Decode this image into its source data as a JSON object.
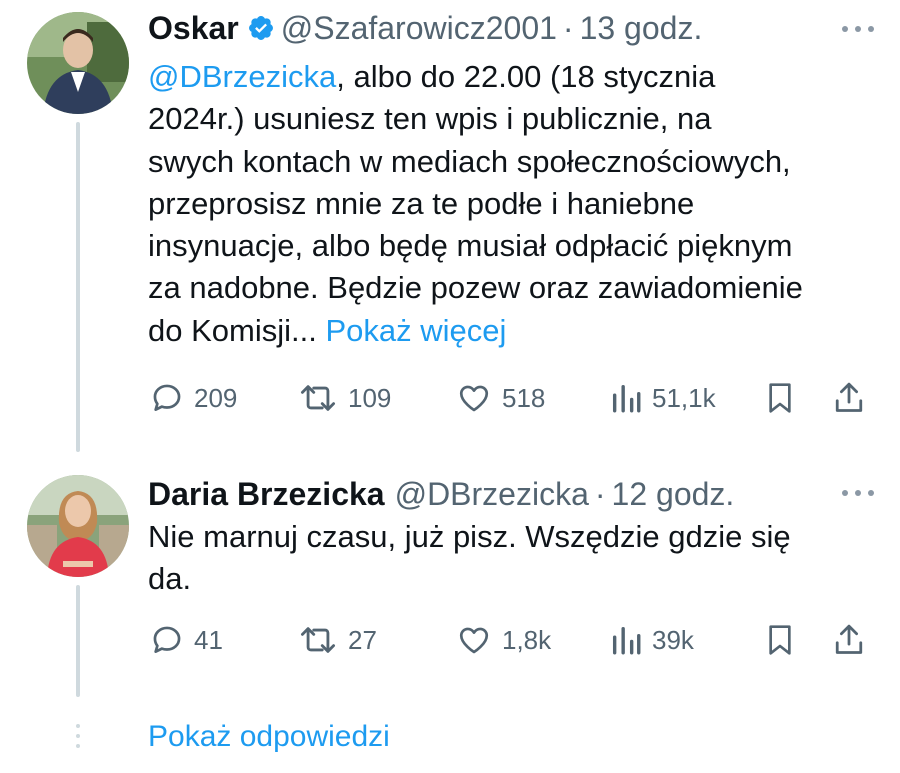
{
  "tweets": [
    {
      "name": "Oskar",
      "verified": true,
      "handle": "@Szafarowicz2001",
      "separator": "·",
      "time": "13 godz.",
      "mention": "@DBrzezicka",
      "text_lines": [
        ", albo do 22.00 (18 stycznia",
        "2024r.) usuniesz ten wpis i publicznie, na",
        "swych kontach w mediach społecznościowych,",
        "przeprosisz mnie za te podłe i haniebne",
        "insynuacje, albo będę musiał odpłacić pięknym",
        "za nadobne. Będzie pozew oraz zawiadomienie",
        "do Komisji..."
      ],
      "show_more": "Pokaż więcej",
      "actions": {
        "replies": "209",
        "retweets": "109",
        "likes": "518",
        "views": "51,1k"
      }
    },
    {
      "name": "Daria Brzezicka",
      "verified": false,
      "handle": "@DBrzezicka",
      "separator": "·",
      "time": "12 godz.",
      "text_lines": [
        "Nie marnuj czasu, już pisz. Wszędzie gdzie się",
        "da."
      ],
      "actions": {
        "replies": "41",
        "retweets": "27",
        "likes": "1,8k",
        "views": "39k"
      }
    }
  ],
  "show_replies": "Pokaż odpowiedzi",
  "colors": {
    "text": "#0f1419",
    "secondary": "#536471",
    "link": "#1d9bf0",
    "thread_line": "#cfd9de",
    "verified_badge": "#1d9bf0"
  },
  "icons": [
    "verified-badge-icon",
    "more-options-icon",
    "reply-icon",
    "retweet-icon",
    "like-icon",
    "views-icon",
    "bookmark-icon",
    "share-icon"
  ]
}
